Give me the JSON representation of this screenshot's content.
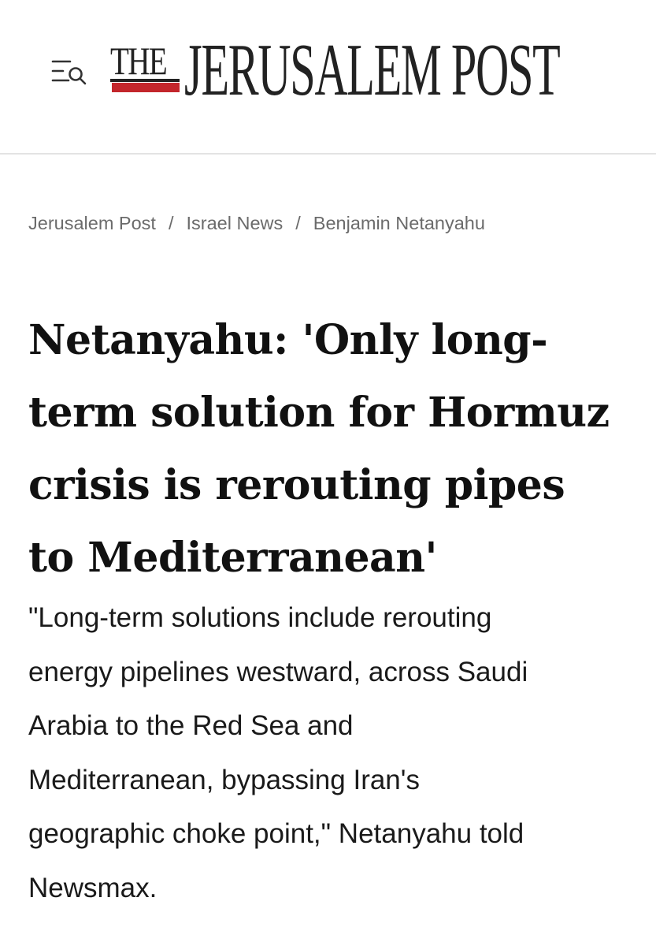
{
  "header": {
    "menu_button_icon": "menu-search-icon",
    "logo": {
      "the": "THE",
      "main": "JERUSALEM POST",
      "accent_color": "#c3262c"
    }
  },
  "breadcrumb": {
    "items": [
      "Jerusalem Post",
      "Israel News",
      "Benjamin Netanyahu"
    ],
    "separator": "/"
  },
  "article": {
    "headline_lines": [
      "Netanyahu: 'Only long-",
      "term solution for Hormuz",
      "crisis is rerouting pipes",
      "to Mediterranean'"
    ],
    "summary_lines": [
      "\"Long-term solutions include rerouting",
      "energy pipelines westward, across Saudi",
      "Arabia to the Red Sea and",
      "Mediterranean, bypassing Iran's",
      "geographic choke point,\" Netanyahu told",
      "Newsmax."
    ]
  }
}
